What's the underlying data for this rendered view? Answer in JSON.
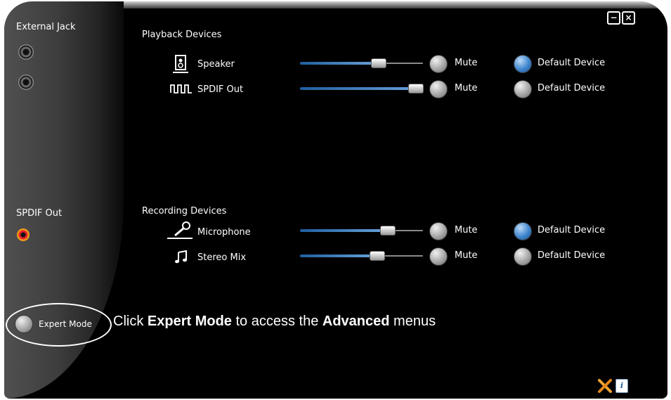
{
  "window_controls": {
    "minimize_glyph": "−",
    "close_glyph": "×"
  },
  "sidebar": {
    "external_jack_label": "External Jack",
    "spdif_out_label": "SPDIF Out",
    "expert_mode_label": "Expert Mode"
  },
  "playback": {
    "title": "Playback Devices",
    "devices": [
      {
        "name": "Speaker",
        "icon": "speaker-icon",
        "volume": 0.7,
        "mute_label": "Mute",
        "default_label": "Default Device",
        "is_default": true
      },
      {
        "name": "SPDIF Out",
        "icon": "spdif-icon",
        "volume": 1.0,
        "mute_label": "Mute",
        "default_label": "Default Device",
        "is_default": false
      }
    ]
  },
  "recording": {
    "title": "Recording Devices",
    "devices": [
      {
        "name": "Microphone",
        "icon": "microphone-icon",
        "volume": 0.75,
        "mute_label": "Mute",
        "default_label": "Default Device",
        "is_default": true
      },
      {
        "name": "Stereo Mix",
        "icon": "music-note-icon",
        "volume": 0.65,
        "mute_label": "Mute",
        "default_label": "Default Device",
        "is_default": false
      }
    ]
  },
  "caption": {
    "part1": "Click ",
    "bold1": "Expert Mode",
    "part2": " to access the ",
    "bold2": "Advanced",
    "part3": " menus"
  },
  "footer_icons": [
    "tools-icon",
    "info-icon"
  ],
  "colors": {
    "accent_blue": "#3f86d0",
    "spdif_jack": "#e4202b",
    "tools": "#f2a531"
  }
}
